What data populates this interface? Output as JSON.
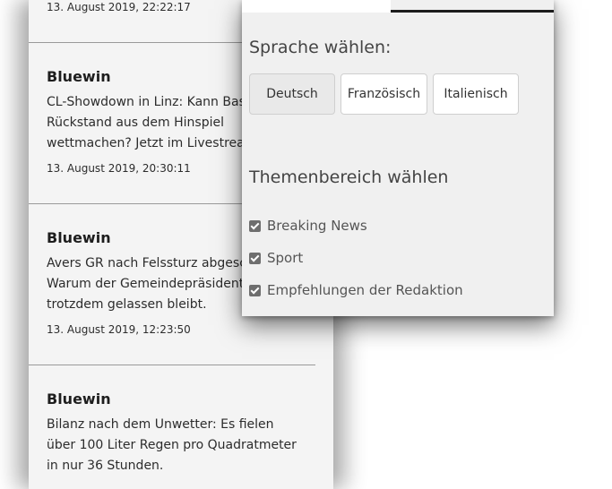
{
  "feed": {
    "items": [
      {
        "source": "",
        "headline": "",
        "timestamp": "13. August 2019, 22:22:17"
      },
      {
        "source": "Bluewin",
        "headline": "CL-Showdown in Linz: Kann Bas\nRückstand aus dem Hinspiel\nwettmachen? Jetzt im Livestrea",
        "timestamp": "13. August 2019, 20:30:11"
      },
      {
        "source": "Bluewin",
        "headline": "Avers GR nach Felssturz abgesch\nWarum der Gemeindepräsident\ntrotzdem gelassen bleibt.",
        "timestamp": "13. August 2019, 12:23:50"
      },
      {
        "source": "Bluewin",
        "headline": "Bilanz nach dem Unwetter: Es fielen\nüber 100 Liter Regen pro Quadratmeter\nin nur 36 Stunden.",
        "timestamp": ""
      }
    ]
  },
  "settings": {
    "language_title": "Sprache wählen:",
    "languages": [
      {
        "label": "Deutsch",
        "selected": true
      },
      {
        "label": "Französisch",
        "selected": false
      },
      {
        "label": "Italienisch",
        "selected": false
      }
    ],
    "topic_title": "Themenbereich wählen",
    "topics": [
      {
        "label": "Breaking News",
        "checked": true
      },
      {
        "label": "Sport",
        "checked": true
      },
      {
        "label": "Empfehlungen der Redaktion",
        "checked": true
      }
    ]
  }
}
